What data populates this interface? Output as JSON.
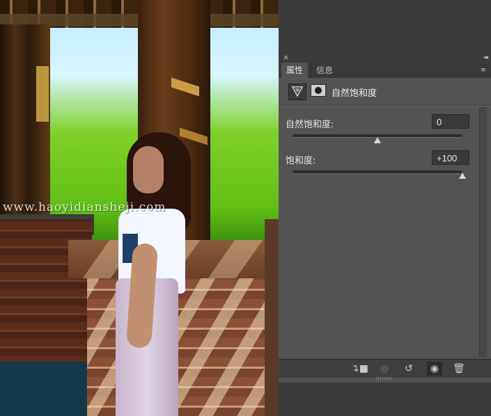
{
  "canvas": {
    "watermark": "www.haoyidiansheji.com"
  },
  "panel": {
    "close_icon": "×",
    "collapse_icon": "◂◂",
    "tabs": [
      {
        "label": "属性",
        "active": true
      },
      {
        "label": "信息",
        "active": false
      }
    ],
    "menu_icon": "≡",
    "layer": {
      "name": "自然饱和度"
    },
    "controls": [
      {
        "label": "自然饱和度:",
        "value": "0",
        "slider_fraction": 0.5
      },
      {
        "label": "饱和度:",
        "value": "+100",
        "slider_fraction": 1.0
      }
    ],
    "footer_icons": [
      {
        "name": "clip-to-layer-icon",
        "glyph": "↴■"
      },
      {
        "name": "view-previous-state-icon",
        "glyph": "◎"
      },
      {
        "name": "reset-icon",
        "glyph": "↺"
      },
      {
        "name": "visibility-eye-icon",
        "glyph": "◉"
      },
      {
        "name": "trash-icon",
        "glyph": "🗑"
      }
    ]
  }
}
